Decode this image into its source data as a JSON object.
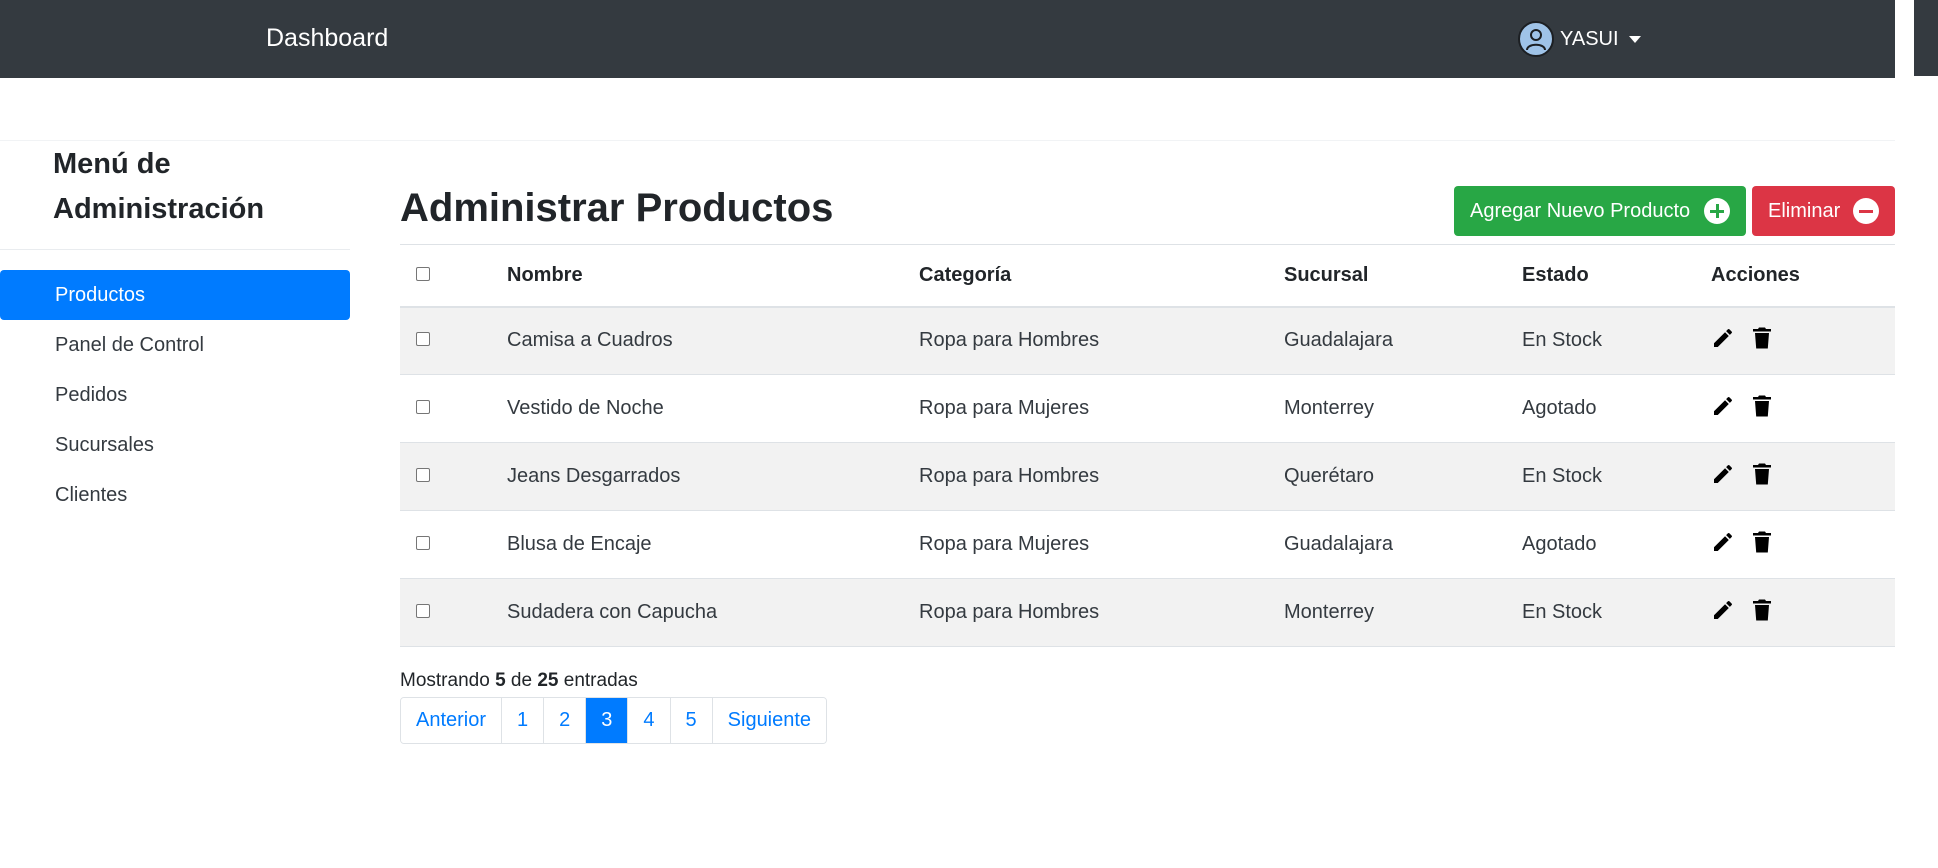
{
  "header": {
    "brand": "Dashboard",
    "user": {
      "name": "YASUI",
      "avatar_icon": "user-avatar-icon"
    }
  },
  "sidebar": {
    "title": "Menú de Administración",
    "items": [
      {
        "label": "Productos",
        "active": true
      },
      {
        "label": "Panel de Control",
        "active": false
      },
      {
        "label": "Pedidos",
        "active": false
      },
      {
        "label": "Sucursales",
        "active": false
      },
      {
        "label": "Clientes",
        "active": false
      }
    ]
  },
  "main": {
    "title_prefix": "Administrar",
    "title_bold": "Productos",
    "add_button": "Agregar Nuevo Producto",
    "delete_button": "Eliminar",
    "table": {
      "headers": {
        "name": "Nombre",
        "category": "Categoría",
        "branch": "Sucursal",
        "status": "Estado",
        "actions": "Acciones"
      },
      "rows": [
        {
          "name": "Camisa a Cuadros",
          "category": "Ropa para Hombres",
          "branch": "Guadalajara",
          "status": "En Stock"
        },
        {
          "name": "Vestido de Noche",
          "category": "Ropa para Mujeres",
          "branch": "Monterrey",
          "status": "Agotado"
        },
        {
          "name": "Jeans Desgarrados",
          "category": "Ropa para Hombres",
          "branch": "Querétaro",
          "status": "En Stock"
        },
        {
          "name": "Blusa de Encaje",
          "category": "Ropa para Mujeres",
          "branch": "Guadalajara",
          "status": "Agotado"
        },
        {
          "name": "Sudadera con Capucha",
          "category": "Ropa para Hombres",
          "branch": "Monterrey",
          "status": "En Stock"
        }
      ]
    },
    "footer": {
      "showing_prefix": "Mostrando",
      "shown": "5",
      "of": "de",
      "total": "25",
      "suffix": "entradas"
    },
    "pagination": {
      "prev": "Anterior",
      "pages": [
        "1",
        "2",
        "3",
        "4",
        "5"
      ],
      "active_page": "3",
      "next": "Siguiente"
    }
  },
  "colors": {
    "topbar": "#343a40",
    "primary": "#007bff",
    "success": "#28a745",
    "danger": "#dc3545"
  }
}
